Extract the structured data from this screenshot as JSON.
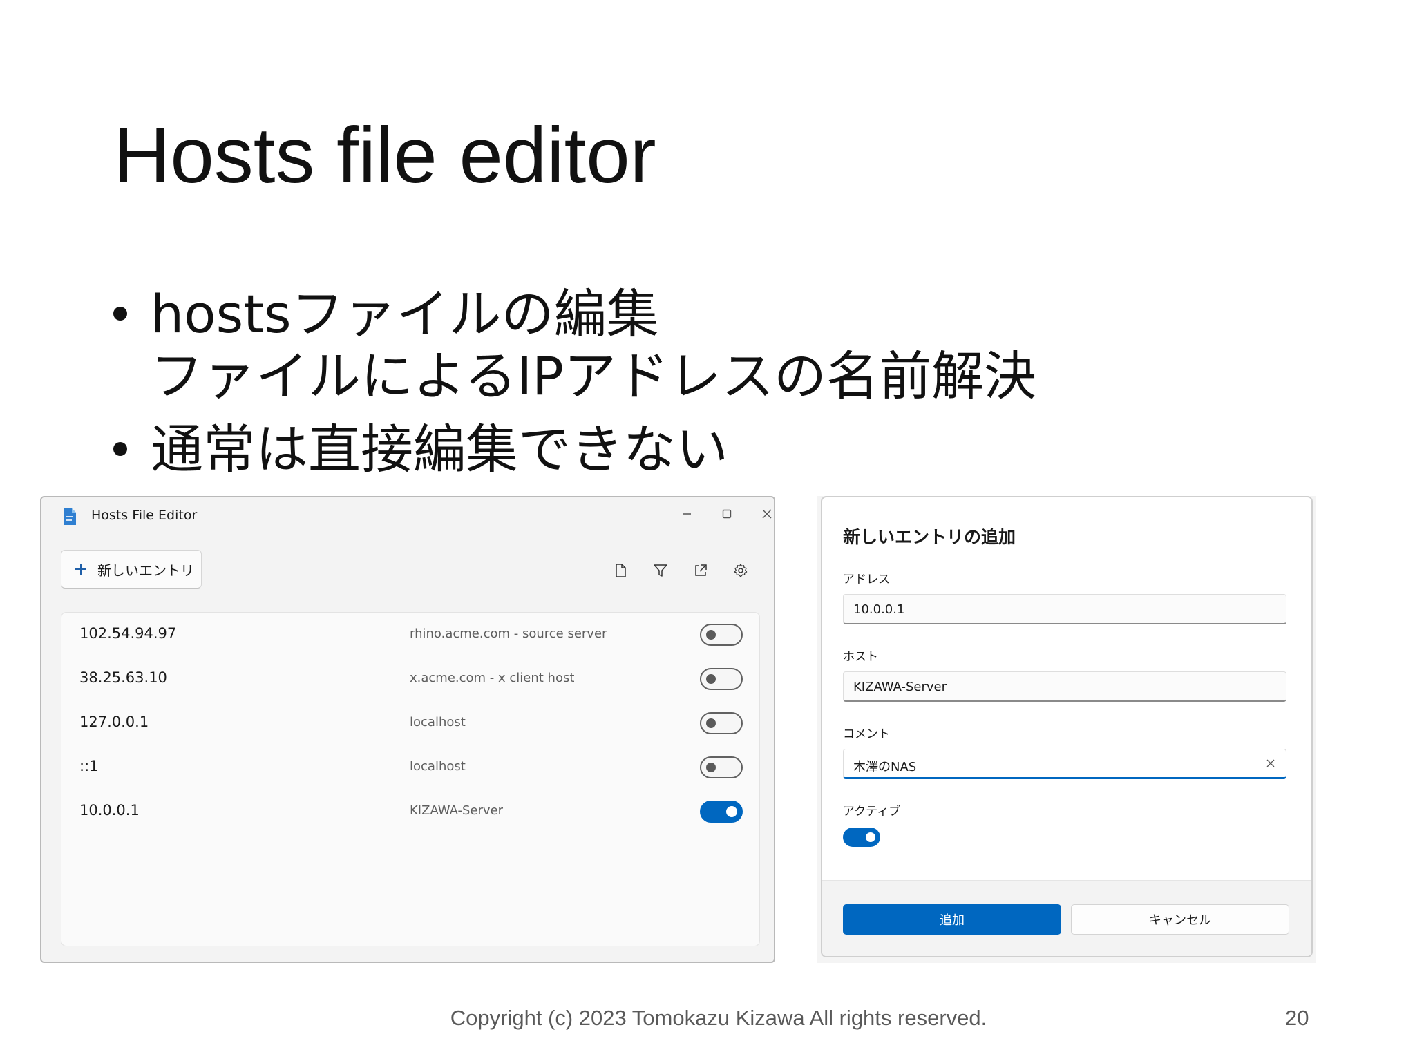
{
  "slide": {
    "title": "Hosts file editor",
    "bullets": [
      {
        "lines": [
          "hostsファイルの編集",
          "ファイルによるIPアドレスの名前解決"
        ]
      },
      {
        "lines": [
          "通常は直接編集できない"
        ]
      }
    ],
    "footer": "Copyright (c) 2023 Tomokazu Kizawa All rights reserved.",
    "page_number": "20"
  },
  "window": {
    "title": "Hosts File Editor",
    "app_icon": "document-icon",
    "caption_buttons": [
      "minimize-icon",
      "maximize-icon",
      "close-icon"
    ],
    "toolbar": {
      "new_entry_label": "新しいエントリ",
      "icons": [
        "file-icon",
        "filter-icon",
        "open-external-icon",
        "gear-icon"
      ]
    },
    "entries": [
      {
        "address": "102.54.94.97",
        "host": "rhino.acme.com - source server",
        "active": false
      },
      {
        "address": "38.25.63.10",
        "host": "x.acme.com - x client host",
        "active": false
      },
      {
        "address": "127.0.0.1",
        "host": "localhost",
        "active": false
      },
      {
        "address": "::1",
        "host": "localhost",
        "active": false
      },
      {
        "address": "10.0.0.1",
        "host": "KIZAWA-Server",
        "active": true
      }
    ]
  },
  "dialog": {
    "title": "新しいエントリの追加",
    "address_label": "アドレス",
    "address_value": "10.0.0.1",
    "host_label": "ホスト",
    "host_value": "KIZAWA-Server",
    "comment_label": "コメント",
    "comment_value": "木澤のNAS",
    "active_label": "アクティブ",
    "active": true,
    "add_label": "追加",
    "cancel_label": "キャンセル"
  },
  "colors": {
    "accent": "#0067c0",
    "window_bg": "#f3f3f3",
    "panel_bg": "#fafafa",
    "muted_text": "#5e5e5e"
  }
}
